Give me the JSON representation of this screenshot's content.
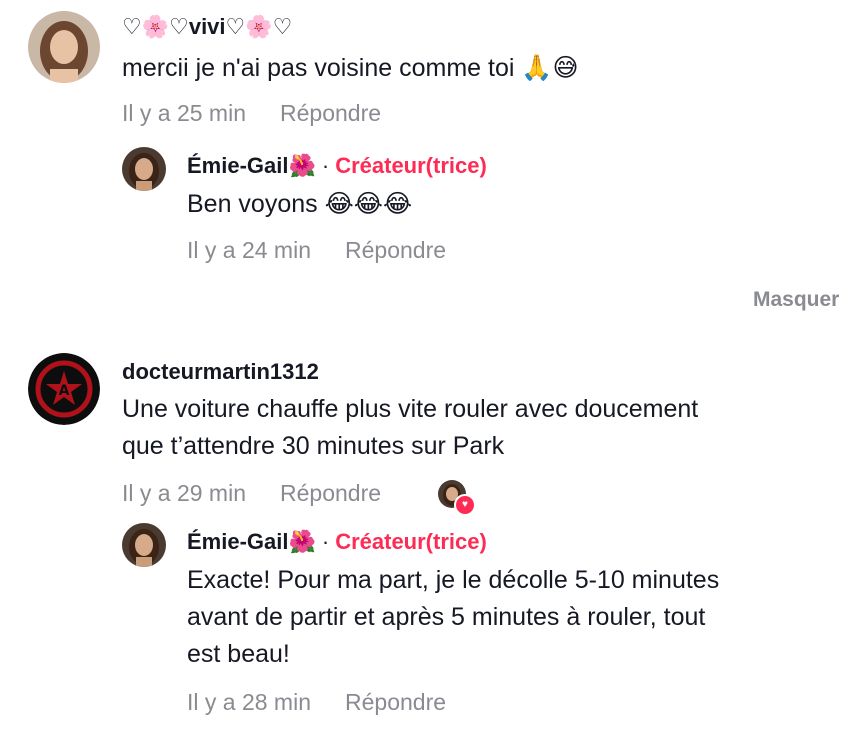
{
  "comments": [
    {
      "username": "♡🌸♡vivi♡🌸♡",
      "text": "mercii je n'ai pas voisine comme toi 🙏😅",
      "time": "Il y a 25 min",
      "reply_label": "Répondre",
      "replies": [
        {
          "username": "Émie-Gail🌺",
          "creator_badge": "Créateur(trice)",
          "separator": "·",
          "text": "Ben voyons 😂😂😂",
          "time": "Il y a 24 min",
          "reply_label": "Répondre"
        }
      ],
      "hide_label": "Masquer"
    },
    {
      "username": "docteurmartin1312",
      "text_lines": [
        "Une voiture chauffe plus vite rouler avec doucement",
        "que t’attendre 30 minutes sur Park"
      ],
      "time": "Il y a 29 min",
      "reply_label": "Répondre",
      "liked_by_creator_icon": "heart-icon",
      "replies": [
        {
          "username": "Émie-Gail🌺",
          "creator_badge": "Créateur(trice)",
          "separator": "·",
          "text_lines": [
            "Exacte! Pour ma part, je le décolle 5-10 minutes",
            "avant de partir et après 5 minutes à rouler, tout",
            "est beau!"
          ],
          "time": "Il y a 28 min",
          "reply_label": "Répondre"
        }
      ]
    }
  ],
  "colors": {
    "accent": "#fe2c55",
    "meta": "#8a8b91",
    "text": "#161823"
  }
}
